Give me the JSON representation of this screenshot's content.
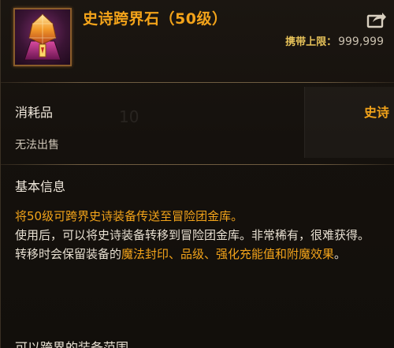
{
  "item": {
    "name": "史诗跨界石（50级）",
    "carry_limit_label": "携带上限：",
    "carry_limit_value": "999,999",
    "type": "消耗品",
    "rarity": "史诗",
    "trade_status": "无法出售"
  },
  "basic_info": {
    "title": "基本信息",
    "line1": "将50级可跨界史诗装备传送至冒险团金库。",
    "line2": "使用后，可以将史诗装备转移到冒险团金库。非常稀有，很难获得。",
    "line3_plain": "转移时会保留装备的",
    "line3_highlight": "魔法封印、品级、强化充能值和附魔效果",
    "line3_end": "。"
  },
  "background_ghost_text": "10",
  "bottom_partial_text": "可以跨界的装备范围",
  "colors": {
    "epic_orange": "#f2a31a",
    "label_gold": "#e8c35a",
    "body_text": "#e8e0d2"
  },
  "icons": {
    "item": "epic-crystal-icon",
    "share": "share-export-icon"
  }
}
